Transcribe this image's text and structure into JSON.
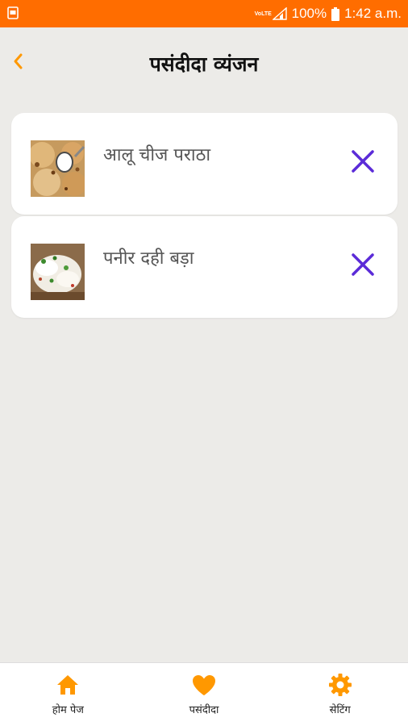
{
  "status_bar": {
    "network_label": "VoLTE",
    "battery_percent": "100%",
    "time": "1:42 a.m."
  },
  "header": {
    "back_icon": "chevron-left-icon",
    "title": "पसंदीदा व्यंजन"
  },
  "favorites": [
    {
      "name": "आलू चीज पराठा",
      "thumbnail": "aloo-paratha-photo",
      "remove_icon": "close-icon"
    },
    {
      "name": "पनीर दही बड़ा",
      "thumbnail": "dahi-bada-photo",
      "remove_icon": "close-icon"
    }
  ],
  "bottom_nav": {
    "items": [
      {
        "label": "होम पेज",
        "icon": "home-icon"
      },
      {
        "label": "पसंदीदा",
        "icon": "heart-icon"
      },
      {
        "label": "सेटिंग",
        "icon": "gear-icon"
      }
    ]
  },
  "colors": {
    "status_bar": "#ff6d00",
    "accent": "#ff9800",
    "remove_icon": "#5b2bd8",
    "background": "#ecebe8"
  }
}
